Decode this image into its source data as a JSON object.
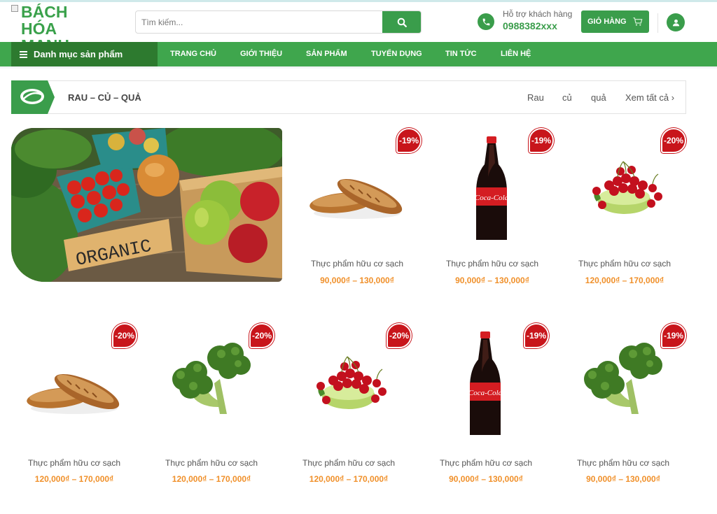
{
  "header": {
    "logo_text": "BÁCH HÓA MANH",
    "search_placeholder": "Tìm kiếm...",
    "support_label": "Hỗ trợ khách hàng",
    "support_phone": "0988382xxx",
    "cart_label": "GIỎ HÀNG"
  },
  "nav": {
    "category_menu": "Danh mục sản phẩm",
    "items": [
      "TRANG CHỦ",
      "GIỚI THIỆU",
      "SẢN PHẨM",
      "TUYỂN DỤNG",
      "TIN TỨC",
      "LIÊN HỆ"
    ]
  },
  "section": {
    "title": "RAU – CỦ – QUẢ",
    "links": [
      "Rau",
      "củ",
      "quả",
      "Xem tất cả ›"
    ]
  },
  "banner": {
    "sign_text": "ORGANIC"
  },
  "products": [
    {
      "name": "Thực phẩm hữu cơ sạch",
      "price": "90,000₫ – 130,000₫",
      "discount": "-19%",
      "image": "bread"
    },
    {
      "name": "Thực phẩm hữu cơ sạch",
      "price": "90,000₫ – 130,000₫",
      "discount": "-19%",
      "image": "cola"
    },
    {
      "name": "Thực phẩm hữu cơ sạch",
      "price": "120,000₫ – 170,000₫",
      "discount": "-20%",
      "image": "cherries"
    },
    {
      "name": "Thực phẩm hữu cơ sạch",
      "price": "120,000₫ – 170,000₫",
      "discount": "-20%",
      "image": "bread"
    },
    {
      "name": "Thực phẩm hữu cơ sạch",
      "price": "120,000₫ – 170,000₫",
      "discount": "-20%",
      "image": "broccoli"
    },
    {
      "name": "Thực phẩm hữu cơ sạch",
      "price": "120,000₫ – 170,000₫",
      "discount": "-20%",
      "image": "cherries"
    },
    {
      "name": "Thực phẩm hữu cơ sạch",
      "price": "90,000₫ – 130,000₫",
      "discount": "-19%",
      "image": "cola"
    },
    {
      "name": "Thực phẩm hữu cơ sạch",
      "price": "90,000₫ – 130,000₫",
      "discount": "-19%",
      "image": "broccoli"
    }
  ],
  "colors": {
    "brand_green": "#3a9d4b",
    "dark_green": "#2d7a2f",
    "price_orange": "#f0902a",
    "badge_red": "#c8151b"
  }
}
